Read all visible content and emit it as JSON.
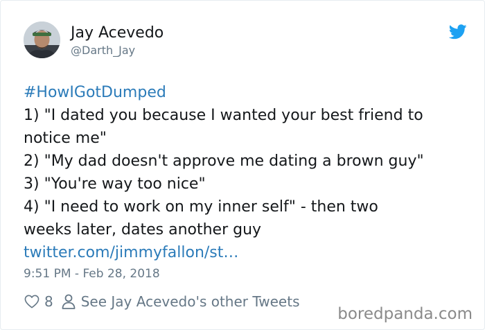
{
  "tweet": {
    "author": {
      "display_name": "Jay Acevedo",
      "handle": "@Darth_Jay",
      "avatar_icon": "avatar-photo"
    },
    "brand_icon": "twitter-bird-icon",
    "brand_color": "#1da1f2",
    "link_color": "#2b7bb9",
    "hashtag": "#HowIGotDumped",
    "lines": [
      "1) \"I dated you because I wanted your best friend to",
      "notice me\"",
      "2) \"My dad doesn't approve me dating a brown guy\"",
      "3) \"You're way too nice\"",
      "4) \"I need to work on my inner self\" - then two",
      "weeks later, dates another guy"
    ],
    "link": "twitter.com/jimmyfallon/st…",
    "timestamp": "9:51 PM - Feb 28, 2018",
    "actions": {
      "like_icon": "heart-icon",
      "like_count": "8",
      "profile_icon": "person-icon",
      "other_tweets": "See Jay Acevedo's other Tweets"
    }
  },
  "watermark": "boredpanda.com"
}
